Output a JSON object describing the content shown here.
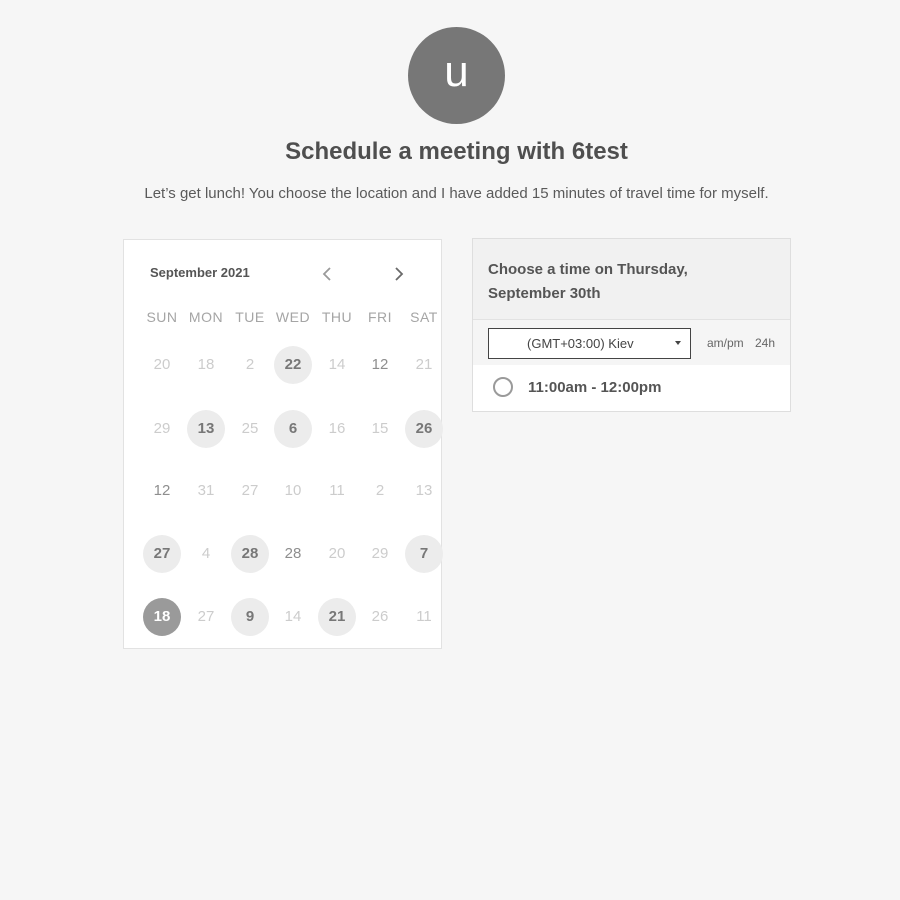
{
  "header": {
    "avatar_letter": "u",
    "title": "Schedule a meeting with 6test",
    "description": "Let’s get lunch! You choose the location and I have added 15 minutes of travel time for myself."
  },
  "calendar": {
    "month_label": "September 2021",
    "prev_icon": "chevron-left-icon",
    "next_icon": "chevron-right-icon",
    "weekdays": [
      "SUN",
      "MON",
      "TUE",
      "WED",
      "THU",
      "FRI",
      "SAT"
    ],
    "weeks": [
      [
        {
          "label": "20",
          "state": "disabled"
        },
        {
          "label": "18",
          "state": "disabled"
        },
        {
          "label": "2",
          "state": "disabled"
        },
        {
          "label": "22",
          "state": "available"
        },
        {
          "label": "14",
          "state": "disabled"
        },
        {
          "label": "12",
          "state": "enabled"
        },
        {
          "label": "21",
          "state": "disabled"
        }
      ],
      [
        {
          "label": "29",
          "state": "disabled"
        },
        {
          "label": "13",
          "state": "available"
        },
        {
          "label": "25",
          "state": "disabled"
        },
        {
          "label": "6",
          "state": "available"
        },
        {
          "label": "16",
          "state": "disabled"
        },
        {
          "label": "15",
          "state": "disabled"
        },
        {
          "label": "26",
          "state": "available"
        }
      ],
      [
        {
          "label": "12",
          "state": "enabled"
        },
        {
          "label": "31",
          "state": "disabled"
        },
        {
          "label": "27",
          "state": "disabled"
        },
        {
          "label": "10",
          "state": "disabled"
        },
        {
          "label": "11",
          "state": "disabled"
        },
        {
          "label": "2",
          "state": "disabled"
        },
        {
          "label": "13",
          "state": "disabled"
        }
      ],
      [
        {
          "label": "27",
          "state": "available"
        },
        {
          "label": "4",
          "state": "disabled"
        },
        {
          "label": "28",
          "state": "available"
        },
        {
          "label": "28",
          "state": "enabled"
        },
        {
          "label": "20",
          "state": "disabled"
        },
        {
          "label": "29",
          "state": "disabled"
        },
        {
          "label": "7",
          "state": "available"
        }
      ],
      [
        {
          "label": "18",
          "state": "selected"
        },
        {
          "label": "27",
          "state": "disabled"
        },
        {
          "label": "9",
          "state": "available"
        },
        {
          "label": "14",
          "state": "disabled"
        },
        {
          "label": "21",
          "state": "available"
        },
        {
          "label": "26",
          "state": "disabled"
        },
        {
          "label": "11",
          "state": "disabled"
        }
      ]
    ]
  },
  "time_panel": {
    "title": "Choose a time on Thursday, September 30th",
    "timezone_value": "(GMT+03:00) Kiev",
    "format_ampm": "am/pm",
    "format_24h": "24h",
    "slots": [
      {
        "label": "11:00am - 12:00pm",
        "selected": false
      }
    ]
  },
  "colors": {
    "background": "#f6f6f6",
    "avatar": "#777777",
    "selected_day": "#9a9a9a",
    "available_day": "#ececec"
  }
}
